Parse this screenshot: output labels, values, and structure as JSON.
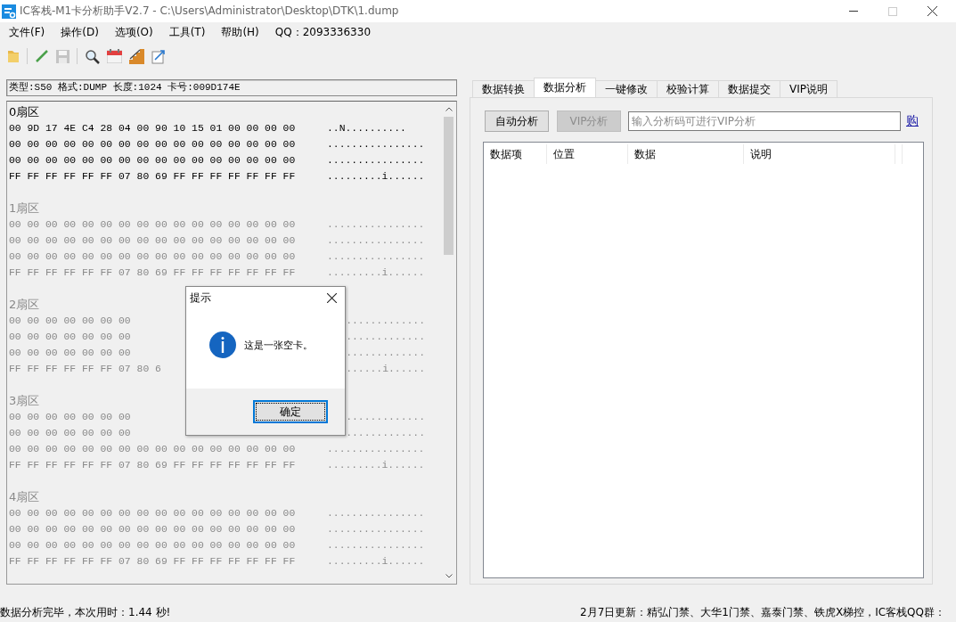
{
  "window": {
    "title": "IC客栈-M1卡分析助手V2.7 - C:\\Users\\Administrator\\Desktop\\DTK\\1.dump"
  },
  "menu": [
    "文件(F)",
    "操作(D)",
    "选项(O)",
    "工具(T)",
    "帮助(H)",
    "QQ：2093336330"
  ],
  "toolbar": [
    {
      "kind": "folder",
      "disabled": false
    },
    {
      "kind": "sep"
    },
    {
      "kind": "pencil",
      "disabled": false
    },
    {
      "kind": "save",
      "disabled": true
    },
    {
      "kind": "sep"
    },
    {
      "kind": "search",
      "disabled": false
    },
    {
      "kind": "calendar",
      "disabled": false
    },
    {
      "kind": "chart",
      "disabled": false
    },
    {
      "kind": "tool",
      "disabled": false
    }
  ],
  "info": "类型:S50 格式:DUMP 长度:1024 卡号:009D174E",
  "sectors": [
    {
      "label": "0扇区",
      "dimmed": false,
      "rows": [
        {
          "hex": "00 9D 17 4E C4 28 04 00 90 10 15 01 00 00 00 00",
          "ascii": "..N.........."
        },
        {
          "hex": "00 00 00 00 00 00 00 00 00 00 00 00 00 00 00 00",
          "ascii": "................"
        },
        {
          "hex": "00 00 00 00 00 00 00 00 00 00 00 00 00 00 00 00",
          "ascii": "................"
        },
        {
          "hex": "FF FF FF FF FF FF 07 80 69 FF FF FF FF FF FF FF",
          "ascii": ".........i......"
        }
      ]
    },
    {
      "label": "1扇区",
      "dimmed": true,
      "rows": [
        {
          "hex": "00 00 00 00 00 00 00 00 00 00 00 00 00 00 00 00",
          "ascii": "................"
        },
        {
          "hex": "00 00 00 00 00 00 00 00 00 00 00 00 00 00 00 00",
          "ascii": "................"
        },
        {
          "hex": "00 00 00 00 00 00 00 00 00 00 00 00 00 00 00 00",
          "ascii": "................"
        },
        {
          "hex": "FF FF FF FF FF FF 07 80 69 FF FF FF FF FF FF FF",
          "ascii": ".........i......"
        }
      ]
    },
    {
      "label": "2扇区",
      "dimmed": true,
      "rows": [
        {
          "kind": "partial",
          "hex": "00 00 00 00 00 00 00",
          "ascii": "............."
        },
        {
          "kind": "partial",
          "hex": "00 00 00 00 00 00 00",
          "ascii": "............."
        },
        {
          "kind": "partial",
          "hex": "00 00 00 00 00 00 00",
          "ascii": "............."
        },
        {
          "kind": "partial",
          "hex": "FF FF FF FF FF FF 07 80 6",
          "ascii": "......i......"
        }
      ]
    },
    {
      "label": "3扇区",
      "dimmed": true,
      "rows": [
        {
          "kind": "partial",
          "hex": "00 00 00 00 00 00 00",
          "ascii": "............."
        },
        {
          "kind": "partial",
          "hex": "00 00 00 00 00 00 00",
          "ascii": "............."
        },
        {
          "hex": "00 00 00 00 00 00 00 00 00 00 00 00 00 00 00 00",
          "ascii": "................"
        },
        {
          "hex": "FF FF FF FF FF FF 07 80 69 FF FF FF FF FF FF FF",
          "ascii": ".........i......"
        }
      ]
    },
    {
      "label": "4扇区",
      "dimmed": true,
      "rows": [
        {
          "hex": "00 00 00 00 00 00 00 00 00 00 00 00 00 00 00 00",
          "ascii": "................"
        },
        {
          "hex": "00 00 00 00 00 00 00 00 00 00 00 00 00 00 00 00",
          "ascii": "................"
        },
        {
          "hex": "00 00 00 00 00 00 00 00 00 00 00 00 00 00 00 00",
          "ascii": "................"
        },
        {
          "hex": "FF FF FF FF FF FF 07 80 69 FF FF FF FF FF FF FF",
          "ascii": ".........i......"
        }
      ]
    }
  ],
  "tabs": [
    {
      "label": "数据转换",
      "selected": false
    },
    {
      "label": "数据分析",
      "selected": true
    },
    {
      "label": "一键修改",
      "selected": false
    },
    {
      "label": "校验计算",
      "selected": false
    },
    {
      "label": "数据提交",
      "selected": false
    },
    {
      "label": "VIP说明",
      "selected": false
    }
  ],
  "buttons": [
    {
      "label": "自动分析",
      "disabled": false
    },
    {
      "label": "VIP分析",
      "disabled": true
    }
  ],
  "code_field": {
    "placeholder": "输入分析码可进行VIP分析"
  },
  "buy_link": "购",
  "table": {
    "columns": [
      "数据项",
      "位置",
      "数据",
      "说明"
    ]
  },
  "dialog": {
    "title": "提示",
    "message": "这是一张空卡。",
    "button": "确定"
  },
  "status_bar": {
    "left": "数据分析完毕，本次用时：1.44 秒!",
    "right": "2月7日更新：精弘门禁、大华1门禁、嘉泰门禁、铁虎X梯控，IC客栈QQ群："
  }
}
